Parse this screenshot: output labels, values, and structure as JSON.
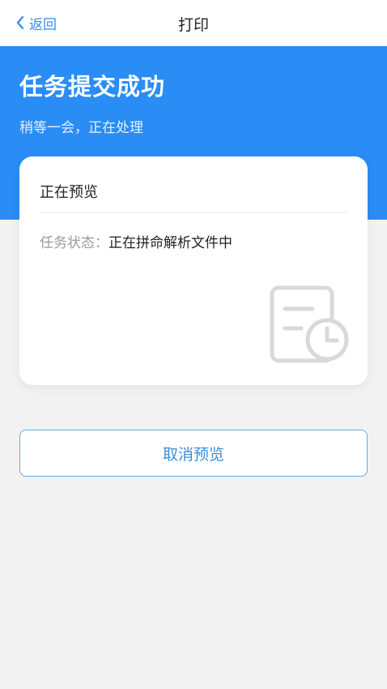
{
  "header": {
    "back_label": "返回",
    "title": "打印"
  },
  "hero": {
    "title": "任务提交成功",
    "subtitle": "稍等一会，正在处理"
  },
  "card": {
    "title": "正在预览",
    "status_label": "任务状态：",
    "status_value": "正在拼命解析文件中",
    "icon": "document-clock-icon"
  },
  "actions": {
    "cancel_label": "取消预览"
  },
  "colors": {
    "accent": "#2a8cf5",
    "link": "#2f8ff0",
    "background": "#f2f2f3"
  }
}
